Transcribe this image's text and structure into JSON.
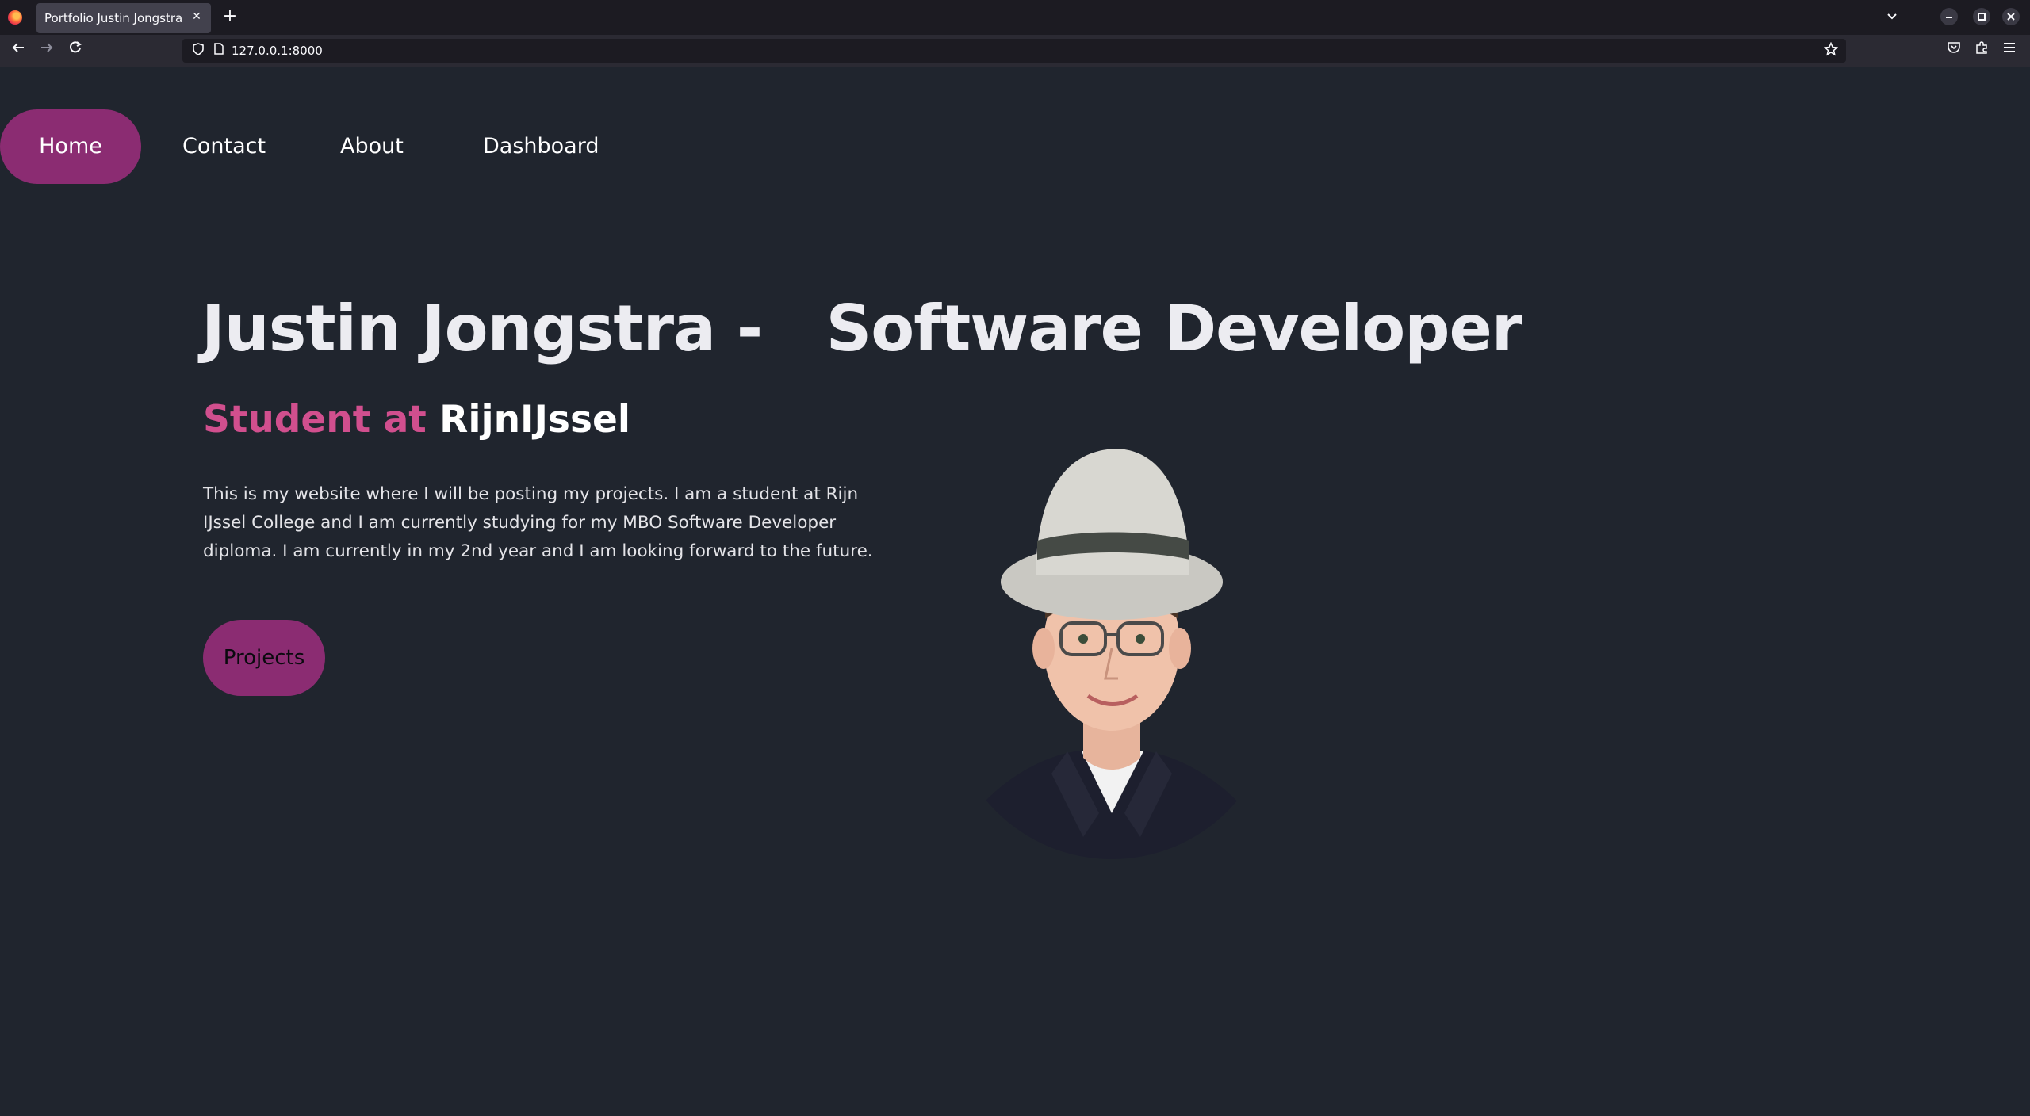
{
  "browser": {
    "tab_title": "Portfolio Justin Jongstra",
    "url": "127.0.0.1:8000",
    "tab_close_glyph": "✕",
    "new_tab_glyph": "+",
    "tab_list_glyph": "⌄"
  },
  "site": {
    "nav": [
      {
        "label": "Home",
        "active": true
      },
      {
        "label": "Contact",
        "active": false
      },
      {
        "label": "About",
        "active": false
      },
      {
        "label": "Dashboard",
        "active": false
      }
    ],
    "hero": {
      "title": "Justin Jongstra -   Software Developer",
      "subtitle_accent": "Student at",
      "subtitle_rest": "RijnIJssel",
      "description": "This is my website where I will be posting my projects. I am a student at Rijn IJssel College and I am currently studying for my MBO Software Developer diploma. I am currently in my 2nd year and I am looking forward to the future.",
      "button_label": "Projects"
    }
  },
  "colors": {
    "page_bg": "#20252e",
    "accent": "#8b2c72",
    "subtitle_accent": "#d14f8e",
    "text": "#ececf1"
  },
  "icons": {
    "back": "back-arrow-icon",
    "forward": "forward-arrow-icon",
    "reload": "reload-icon",
    "shield": "tracking-protection-shield-icon",
    "page": "page-info-icon",
    "bookmark": "star-icon",
    "pocket": "pocket-icon",
    "extensions": "extensions-icon",
    "menu": "hamburger-menu-icon",
    "portrait": "portrait-photo"
  }
}
